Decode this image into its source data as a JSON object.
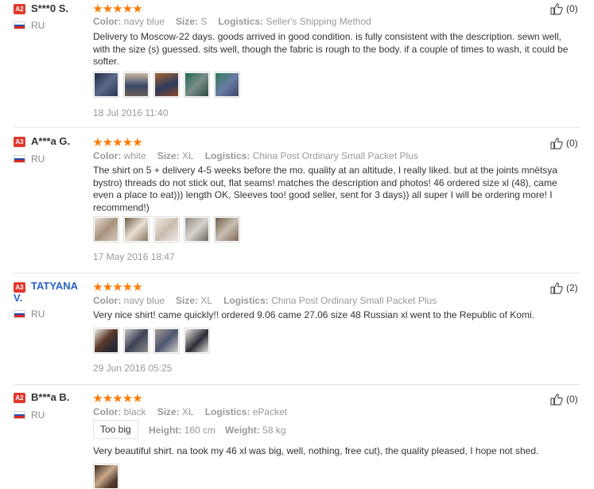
{
  "labels": {
    "color": "Color:",
    "size": "Size:",
    "logistics": "Logistics:",
    "height": "Height:",
    "weight": "Weight:"
  },
  "colors": {
    "badge": "#e0382c",
    "star": "#ff7a00",
    "name_blue": "#2662c4",
    "meta": "#999999"
  },
  "reviews": [
    {
      "badge": "A2",
      "name": "S***0 S.",
      "country": "RU",
      "rating": 5,
      "color": "navy blue",
      "size": "S",
      "logistics": "Seller's Shipping Method",
      "text": "Delivery to Moscow-22 days. goods arrived in good condition. is fully consistent with the description. sewn well, with the size (s) guessed. sits well, though the fabric is rough to the body. if a couple of times to wash, it could be softer.",
      "photo_count": 5,
      "date": "18 Jul 2016 11:40",
      "likes": "(0)"
    },
    {
      "badge": "A3",
      "name": "A***a G.",
      "country": "RU",
      "rating": 5,
      "color": "white",
      "size": "XL",
      "logistics": "China Post Ordinary Small Packet Plus",
      "text": "The shirt on 5 + delivery 4-5 weeks before the mo. quality at an altitude, I really liked. but at the joints mnëtsya bystro) threads do not stick out, flat seams! matches the description and photos! 46 ordered size xl (48), came even a place to eat))) length OK, Sleeves too! good seller, sent for 3 days)) all super I will be ordering more! I recommend!)",
      "photo_count": 5,
      "date": "17 May 2016 18:47",
      "likes": "(0)"
    },
    {
      "badge": "A3",
      "name_line1": "TATYANA",
      "name_line2": "V.",
      "country": "RU",
      "rating": 5,
      "color": "navy blue",
      "size": "XL",
      "logistics": "China Post Ordinary Small Packet Plus",
      "text": "Very nice shirt! came quickly!! ordered 9.06 came 27.06 size 48 Russian xl went to the Republic of Komi.",
      "photo_count": 4,
      "date": "29 Jun 2016 05:25",
      "likes": "(2)"
    },
    {
      "badge": "A2",
      "name": "B***a B.",
      "country": "RU",
      "rating": 5,
      "color": "black",
      "size": "XL",
      "logistics": "ePacket",
      "fit": "Too big",
      "height": "160 cm",
      "weight": "58 kg",
      "text": "Very beautiful shirt. na took my 46 xl was big, well, nothing, free cut), the quality pleased, I hope not shed.",
      "photo_count": 1,
      "likes": "(0)"
    }
  ],
  "icons": {
    "like": "thumbs-up-icon",
    "flag": "russia-flag-icon",
    "star": "star-icon",
    "badge": "level-badge-icon"
  }
}
